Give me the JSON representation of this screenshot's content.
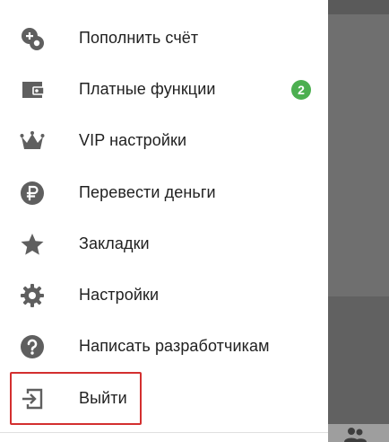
{
  "menu": {
    "items": [
      {
        "label": "Пополнить счёт",
        "icon": "add-funds-coins-icon"
      },
      {
        "label": "Платные функции",
        "icon": "wallet-icon",
        "badge": "2"
      },
      {
        "label": "VIP настройки",
        "icon": "crown-icon"
      },
      {
        "label": "Перевести деньги",
        "icon": "ruble-icon"
      },
      {
        "label": "Закладки",
        "icon": "star-icon"
      },
      {
        "label": "Настройки",
        "icon": "gear-icon"
      },
      {
        "label": "Написать разработчикам",
        "icon": "help-icon"
      },
      {
        "label": "Выйти",
        "icon": "logout-icon"
      }
    ]
  },
  "colors": {
    "icon": "#5f5f5f",
    "text": "#212121",
    "badge": "#4caf50",
    "highlight": "#d32f2f",
    "backdrop": "#6d6d6d"
  },
  "backdrop": {
    "icon": "people-icon"
  }
}
